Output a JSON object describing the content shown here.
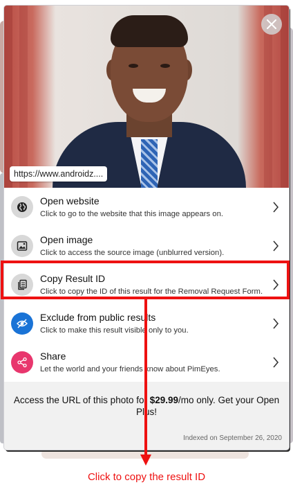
{
  "modal": {
    "source_url": "https://www.androidz....",
    "close_icon": "close-icon"
  },
  "actions": [
    {
      "icon": "globe-icon",
      "title": "Open website",
      "subtitle": "Click to go to the website that this image appears on."
    },
    {
      "icon": "image-icon",
      "title": "Open image",
      "subtitle": "Click to access the source image (unblurred version)."
    },
    {
      "icon": "copy-icon",
      "title": "Copy Result ID",
      "subtitle": "Click to copy the ID of this result for the Removal Request Form."
    },
    {
      "icon": "eye-off-icon",
      "title": "Exclude from public results",
      "subtitle": "Click to make this result visible only to you."
    },
    {
      "icon": "share-icon",
      "title": "Share",
      "subtitle": "Let the world and your friends know about PimEyes."
    }
  ],
  "promo": {
    "before": "Access the URL of this photo for ",
    "price": "$29.99",
    "after": "/mo only. Get your Open Plus!"
  },
  "indexed": "Indexed on September 26, 2020",
  "annotation": {
    "caption": "Click to copy the result ID",
    "color": "#ee1111"
  },
  "colors": {
    "exclude_icon_bg": "#1a73d6",
    "share_icon_bg": "#e8366d"
  }
}
